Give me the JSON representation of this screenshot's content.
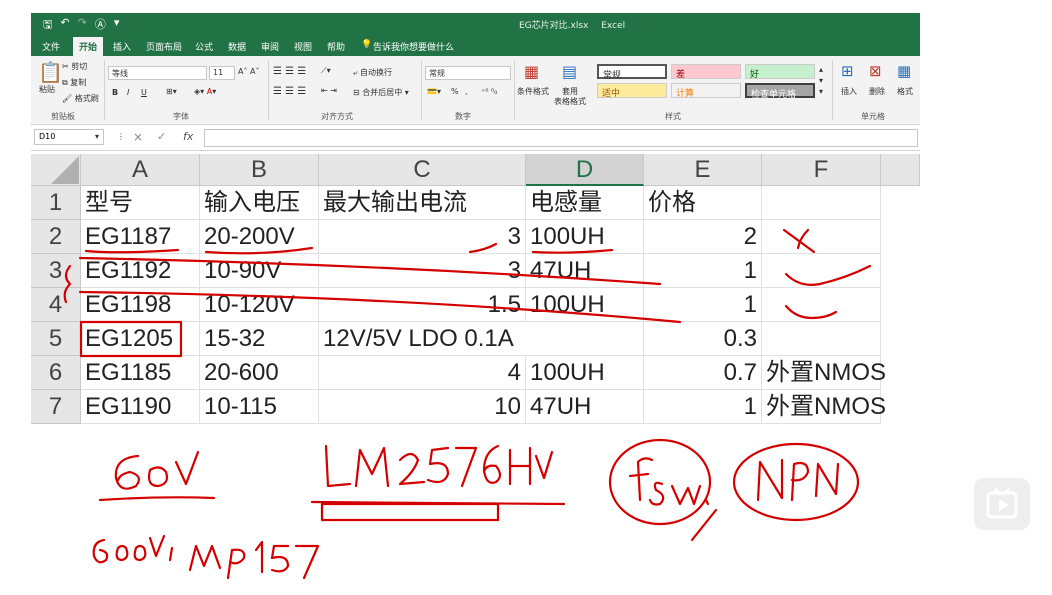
{
  "qat": {
    "save": "🖫",
    "undo": "↶",
    "redo": "↷",
    "misc": "Ⓐ"
  },
  "window": {
    "filename": "EG芯片对比.xlsx",
    "app": "Excel"
  },
  "tabs": [
    "文件",
    "开始",
    "插入",
    "页面布局",
    "公式",
    "数据",
    "审阅",
    "视图",
    "帮助",
    "告诉我你想要做什么"
  ],
  "ribbon": {
    "clipboard": {
      "paste": "粘贴",
      "cut": "剪切",
      "copy": "复制",
      "format_painter": "格式刷",
      "label": "剪贴板"
    },
    "font": {
      "name": "等线",
      "size": "11",
      "bold": "B",
      "italic": "I",
      "underline": "U",
      "label": "字体"
    },
    "alignment": {
      "wrap": "自动换行",
      "merge": "合并后居中",
      "label": "对齐方式"
    },
    "number": {
      "format": "常规",
      "percent": "%",
      "comma": ",",
      "label": "数字"
    },
    "styles": {
      "conditional": "条件格式",
      "table": "套用\n表格格式",
      "table_line1": "套用",
      "table_line2": "表格格式",
      "cells": [
        {
          "text": "常规",
          "bg": "#ffffff",
          "color": "#000000"
        },
        {
          "text": "差",
          "bg": "#ffc7ce",
          "color": "#9c0006"
        },
        {
          "text": "好",
          "bg": "#c6efce",
          "color": "#006100"
        },
        {
          "text": "适中",
          "bg": "#ffeb9c",
          "color": "#9c5700"
        },
        {
          "text": "计算",
          "bg": "#f2f2f2",
          "color": "#fa7d00"
        },
        {
          "text": "检查单元格",
          "bg": "#a5a5a5",
          "color": "#ffffff"
        }
      ],
      "label": "样式"
    },
    "cells_group": {
      "insert": "插入",
      "delete": "删除",
      "format": "格式",
      "label": "单元格"
    }
  },
  "formula_bar": {
    "name_box": "D10",
    "cancel": "×",
    "enter": "✓",
    "fx": "fx",
    "content": ""
  },
  "columns": [
    "A",
    "B",
    "C",
    "D",
    "E",
    "F"
  ],
  "selected_column": "D",
  "rows": [
    {
      "num": "1",
      "cells": [
        "型号",
        "输入电压",
        "最大输出电流",
        "电感量",
        "价格",
        ""
      ]
    },
    {
      "num": "2",
      "cells": [
        "EG1187",
        "20-200V",
        "3",
        "100UH",
        "2",
        ""
      ]
    },
    {
      "num": "3",
      "cells": [
        "EG1192",
        "10-90V",
        "3",
        "47UH",
        "1",
        ""
      ]
    },
    {
      "num": "4",
      "cells": [
        "EG1198",
        "10-120V",
        "1.5",
        "100UH",
        "1",
        ""
      ]
    },
    {
      "num": "5",
      "cells": [
        "EG1205",
        "15-32",
        "12V/5V LDO 0.1A",
        "",
        "0.3",
        ""
      ]
    },
    {
      "num": "6",
      "cells": [
        "EG1185",
        "20-600",
        "4",
        "100UH",
        "0.7",
        "外置NMOS"
      ]
    },
    {
      "num": "7",
      "cells": [
        "EG1190",
        "10-115",
        "10",
        "47UH",
        "1",
        "外置NMOS"
      ]
    }
  ],
  "colors": {
    "excel_green": "#217346",
    "ink_red": "#d40000"
  }
}
